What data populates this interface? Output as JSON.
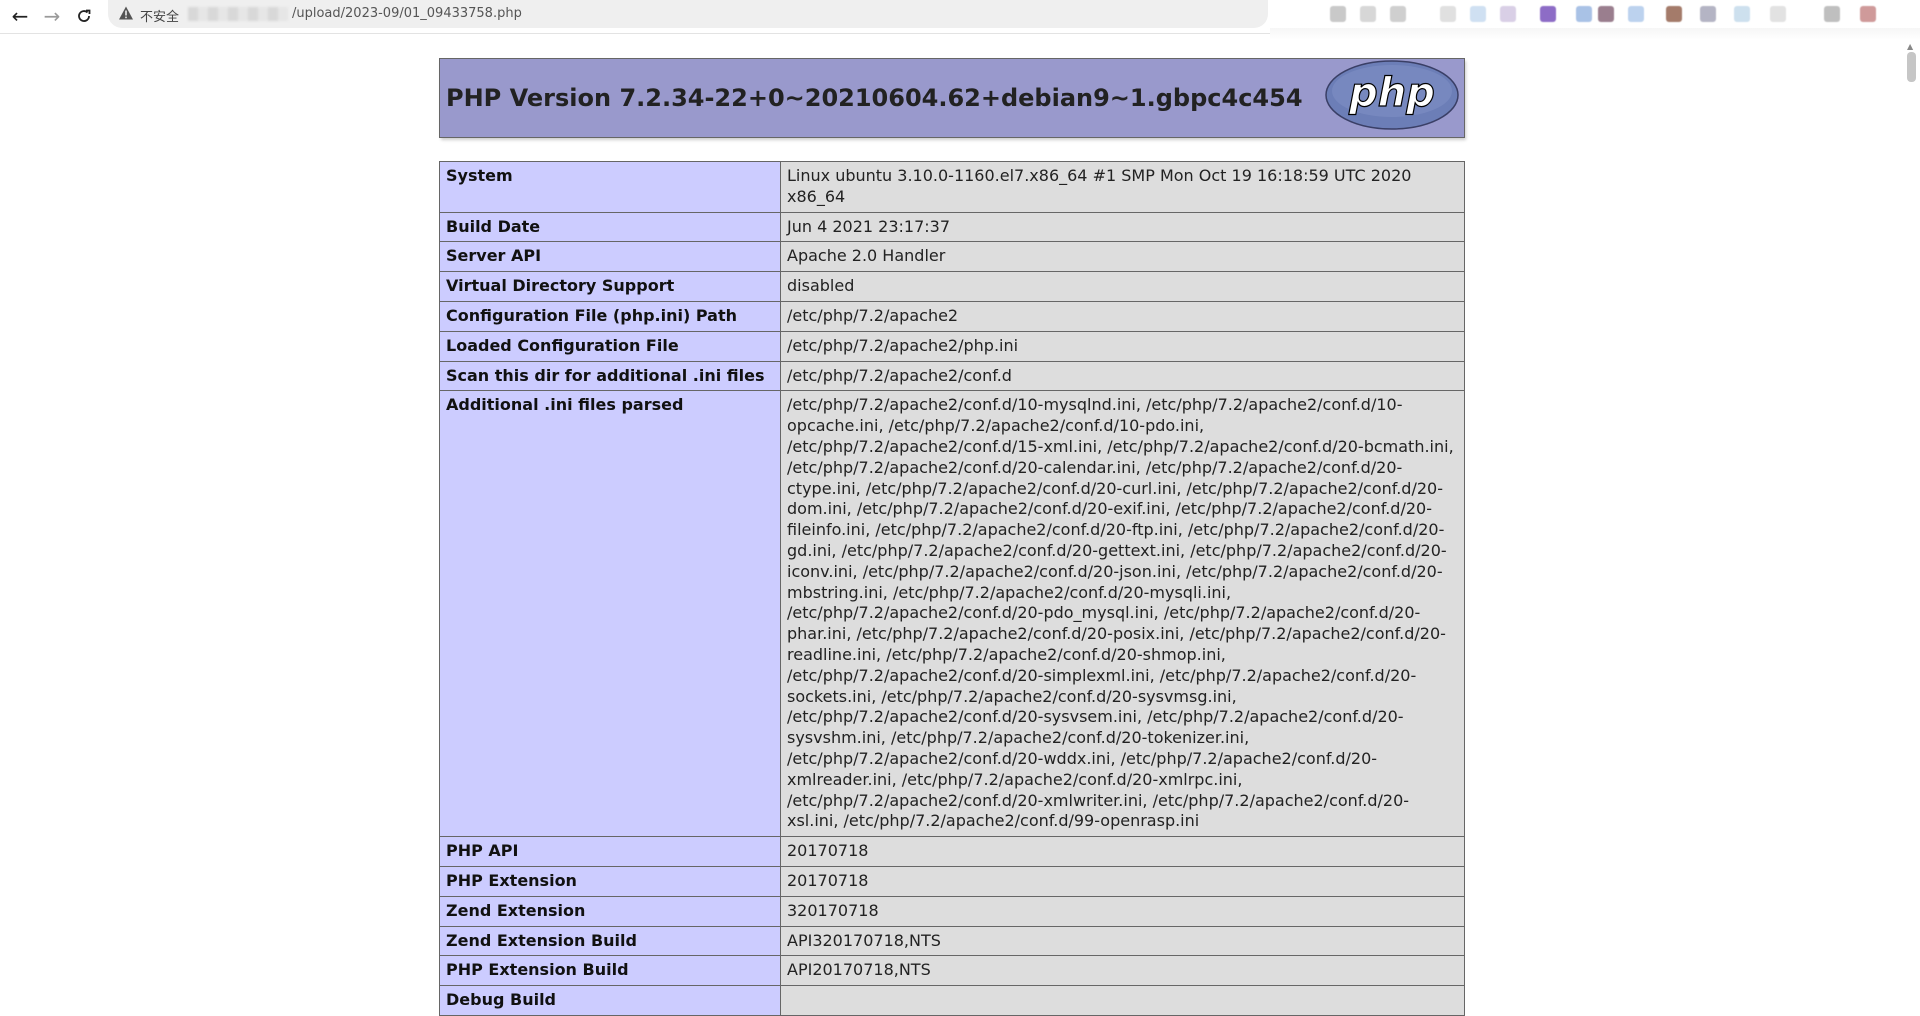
{
  "browser": {
    "insecure_label": "不安全",
    "url_path": "/upload/2023-09/01_09433758.php",
    "back_icon": "arrow-left-icon",
    "forward_icon": "arrow-right-icon",
    "reload_icon": "reload-icon"
  },
  "header": {
    "title": "PHP Version 7.2.34-22+0~20210604.62+debian9~1.gbpc4c454",
    "logo_text": "php"
  },
  "info": {
    "rows": [
      {
        "key": "System",
        "value": "Linux ubuntu 3.10.0-1160.el7.x86_64 #1 SMP Mon Oct 19 16:18:59 UTC 2020 x86_64"
      },
      {
        "key": "Build Date",
        "value": "Jun 4 2021 23:17:37"
      },
      {
        "key": "Server API",
        "value": "Apache 2.0 Handler"
      },
      {
        "key": "Virtual Directory Support",
        "value": "disabled"
      },
      {
        "key": "Configuration File (php.ini) Path",
        "value": "/etc/php/7.2/apache2"
      },
      {
        "key": "Loaded Configuration File",
        "value": "/etc/php/7.2/apache2/php.ini"
      },
      {
        "key": "Scan this dir for additional .ini files",
        "value": "/etc/php/7.2/apache2/conf.d"
      },
      {
        "key": "Additional .ini files parsed",
        "value": "/etc/php/7.2/apache2/conf.d/10-mysqlnd.ini, /etc/php/7.2/apache2/conf.d/10-opcache.ini, /etc/php/7.2/apache2/conf.d/10-pdo.ini, /etc/php/7.2/apache2/conf.d/15-xml.ini, /etc/php/7.2/apache2/conf.d/20-bcmath.ini, /etc/php/7.2/apache2/conf.d/20-calendar.ini, /etc/php/7.2/apache2/conf.d/20-ctype.ini, /etc/php/7.2/apache2/conf.d/20-curl.ini, /etc/php/7.2/apache2/conf.d/20-dom.ini, /etc/php/7.2/apache2/conf.d/20-exif.ini, /etc/php/7.2/apache2/conf.d/20-fileinfo.ini, /etc/php/7.2/apache2/conf.d/20-ftp.ini, /etc/php/7.2/apache2/conf.d/20-gd.ini, /etc/php/7.2/apache2/conf.d/20-gettext.ini, /etc/php/7.2/apache2/conf.d/20-iconv.ini, /etc/php/7.2/apache2/conf.d/20-json.ini, /etc/php/7.2/apache2/conf.d/20-mbstring.ini, /etc/php/7.2/apache2/conf.d/20-mysqli.ini, /etc/php/7.2/apache2/conf.d/20-pdo_mysql.ini, /etc/php/7.2/apache2/conf.d/20-phar.ini, /etc/php/7.2/apache2/conf.d/20-posix.ini, /etc/php/7.2/apache2/conf.d/20-readline.ini, /etc/php/7.2/apache2/conf.d/20-shmop.ini, /etc/php/7.2/apache2/conf.d/20-simplexml.ini, /etc/php/7.2/apache2/conf.d/20-sockets.ini, /etc/php/7.2/apache2/conf.d/20-sysvmsg.ini, /etc/php/7.2/apache2/conf.d/20-sysvsem.ini, /etc/php/7.2/apache2/conf.d/20-sysvshm.ini, /etc/php/7.2/apache2/conf.d/20-tokenizer.ini, /etc/php/7.2/apache2/conf.d/20-wddx.ini, /etc/php/7.2/apache2/conf.d/20-xmlreader.ini, /etc/php/7.2/apache2/conf.d/20-xmlrpc.ini, /etc/php/7.2/apache2/conf.d/20-xmlwriter.ini, /etc/php/7.2/apache2/conf.d/20-xsl.ini, /etc/php/7.2/apache2/conf.d/99-openrasp.ini"
      },
      {
        "key": "PHP API",
        "value": "20170718"
      },
      {
        "key": "PHP Extension",
        "value": "20170718"
      },
      {
        "key": "Zend Extension",
        "value": "320170718"
      },
      {
        "key": "Zend Extension Build",
        "value": "API320170718,NTS"
      },
      {
        "key": "PHP Extension Build",
        "value": "API20170718,NTS"
      },
      {
        "key": "Debug Build",
        "value": ""
      }
    ]
  },
  "colors": {
    "header_bg": "#9999cc",
    "key_bg": "#ccccff",
    "value_bg": "#dddddd",
    "border": "#666666"
  }
}
